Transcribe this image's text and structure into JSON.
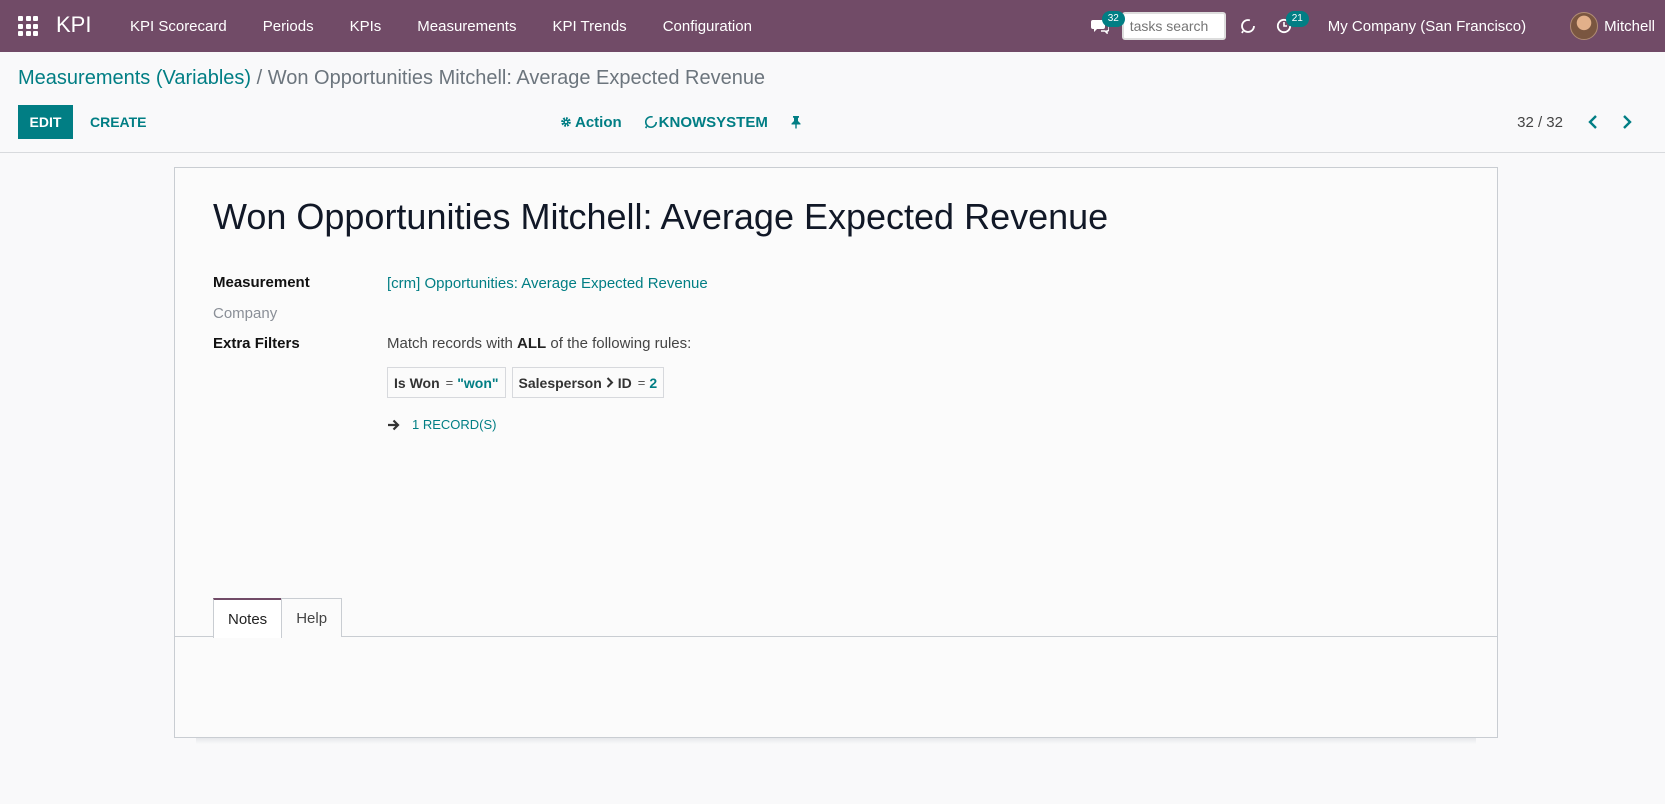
{
  "navbar": {
    "brand": "KPI",
    "menu": [
      "KPI Scorecard",
      "Periods",
      "KPIs",
      "Measurements",
      "KPI Trends",
      "Configuration"
    ],
    "messages_badge": "32",
    "task_search_placeholder": "tasks search",
    "activities_badge": "21",
    "company": "My Company (San Francisco)",
    "user_name": "Mitchell"
  },
  "control_panel": {
    "breadcrumb_parent": "Measurements (Variables)",
    "breadcrumb_separator": "/",
    "breadcrumb_current": "Won Opportunities Mitchell: Average Expected Revenue",
    "edit_label": "EDIT",
    "create_label": "CREATE",
    "action_label": "Action",
    "knowsystem_label": "KNOWSYSTEM",
    "pager_value": "32 / 32"
  },
  "form": {
    "title": "Won Opportunities Mitchell: Average Expected Revenue",
    "measurement_label": "Measurement",
    "measurement_value": "[crm] Opportunities: Average Expected Revenue",
    "company_label": "Company",
    "extra_filters_label": "Extra Filters",
    "filter_intro_before": "Match records with",
    "filter_intro_strong": "ALL",
    "filter_intro_after": "of the following rules:",
    "filters": [
      {
        "field": "Is Won",
        "op": "=",
        "value": "\"won\""
      },
      {
        "field": "Salesperson",
        "field2": "ID",
        "op": "=",
        "value": "2"
      }
    ],
    "records_label": "1 RECORD(S)",
    "tabs": [
      "Notes",
      "Help"
    ]
  },
  "colors": {
    "navbar": "#714b67",
    "accent": "#017e84"
  }
}
